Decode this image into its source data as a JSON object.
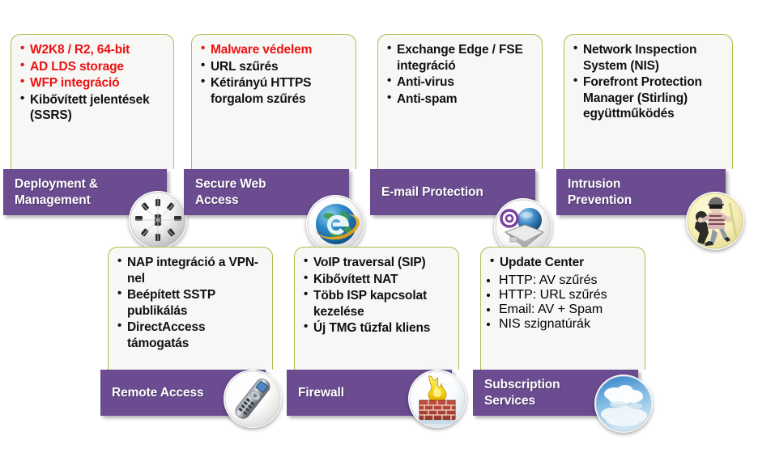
{
  "theme": {
    "banner_color": "#6B4C91",
    "card_border_color": "#A6C34C",
    "card_bg_color": "#F7F7F5",
    "highlight_text_color": "#EE1111",
    "body_text_color": "#111111",
    "banner_text_color": "#FFFFFF",
    "page_bg_color": "#FFFFFF"
  },
  "cards": [
    {
      "id": "deployment-management",
      "title": "Deployment & Management",
      "icon": "dial-knob-icon",
      "bullets": [
        {
          "text": "W2K8 / R2, 64-bit",
          "highlight": true
        },
        {
          "text": "AD LDS storage",
          "highlight": true
        },
        {
          "text": "WFP integráció",
          "highlight": true
        },
        {
          "text": "Kibővített jelentések (SSRS)",
          "highlight": false
        }
      ]
    },
    {
      "id": "secure-web-access",
      "title": "Secure Web Access",
      "icon": "internet-explorer-globe-icon",
      "bullets": [
        {
          "text": "Malware védelem",
          "highlight": true
        },
        {
          "text": "URL szűrés",
          "highlight": false
        },
        {
          "text": "Kétirányú HTTPS forgalom szűrés",
          "highlight": false
        }
      ]
    },
    {
      "id": "email-protection",
      "title": "E-mail Protection",
      "icon": "email-envelope-icon",
      "bullets": [
        {
          "text": "Exchange Edge / FSE integráció",
          "highlight": false
        },
        {
          "text": "Anti-virus",
          "highlight": false
        },
        {
          "text": "Anti-spam",
          "highlight": false
        }
      ]
    },
    {
      "id": "intrusion-prevention",
      "title": "Intrusion Prevention",
      "icon": "burglar-thief-icon",
      "bullets": [
        {
          "text": "Network Inspection System (NIS)",
          "highlight": false
        },
        {
          "text": "Forefront Protection Manager (Stirling) együttműködés",
          "highlight": false
        }
      ]
    },
    {
      "id": "remote-access",
      "title": "Remote Access",
      "icon": "remote-control-icon",
      "bullets": [
        {
          "text": "NAP integráció a VPN-nel",
          "highlight": false
        },
        {
          "text": "Beépített SSTP publikálás",
          "highlight": false
        },
        {
          "text": "DirectAccess támogatás",
          "highlight": false
        }
      ]
    },
    {
      "id": "firewall",
      "title": "Firewall",
      "icon": "firewall-brick-flame-icon",
      "bullets": [
        {
          "text": "VoIP traversal (SIP)",
          "highlight": false
        },
        {
          "text": "Kibővített NAT",
          "highlight": false
        },
        {
          "text": "Több ISP kapcsolat kezelése",
          "highlight": false
        },
        {
          "text": "Új TMG tűzfal kliens",
          "highlight": false
        }
      ]
    },
    {
      "id": "subscription-services",
      "title": "Subscription Services",
      "icon": "cloud-sky-icon",
      "bullets": [
        {
          "text": "Update Center",
          "highlight": false
        }
      ],
      "sub_bullets": [
        {
          "text": "HTTP: AV szűrés",
          "highlight": true
        },
        {
          "text": "HTTP: URL szűrés",
          "highlight": false
        },
        {
          "text": "Email: AV + Spam",
          "highlight": false
        },
        {
          "text": "NIS szignatúrák",
          "highlight": false
        }
      ]
    }
  ]
}
